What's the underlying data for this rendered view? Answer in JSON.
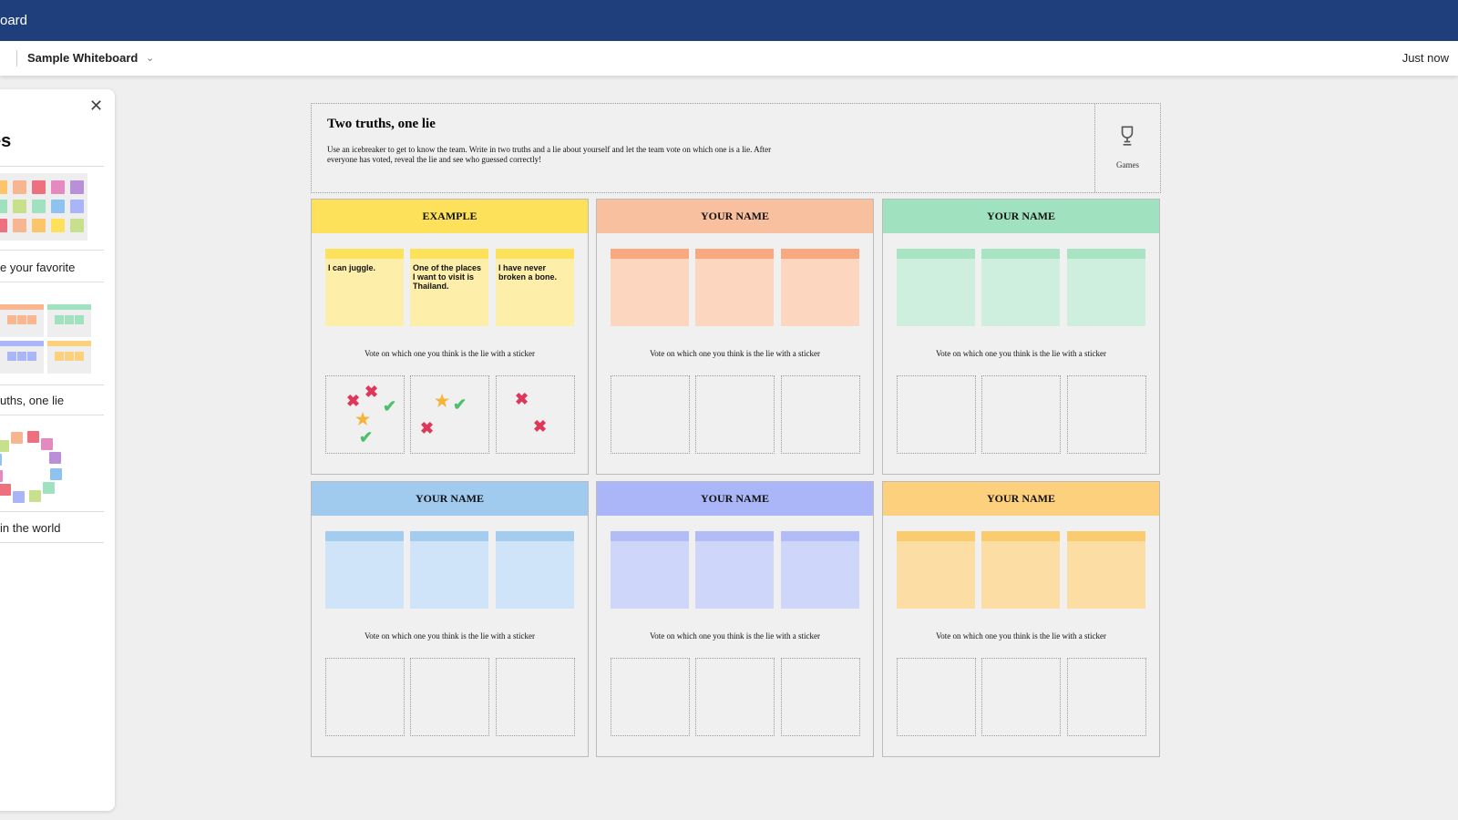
{
  "app": {
    "title": "oard"
  },
  "toolbar": {
    "board_name": "Sample Whiteboard",
    "saved_status": "Just now"
  },
  "panel": {
    "heading": "es",
    "templates": [
      {
        "label": "e your favorite"
      },
      {
        "label": "uths, one lie"
      },
      {
        "label": " in the world"
      }
    ]
  },
  "board": {
    "title": "Two truths, one lie",
    "description": "Use an icebreaker to get to know the team. Write in two truths and a lie about yourself and let the team vote on which one is a lie. After everyone has voted, reveal the lie and see who guessed correctly!",
    "category_label": "Games",
    "category_icon": "trophy-icon",
    "vote_prompt": "Vote on which one you think is the lie with a sticker",
    "cards": [
      {
        "title": "EXAMPLE",
        "header_color": "#fde15a",
        "sticky_color": "#fdeeaa",
        "sticky_bar": "#fde15a",
        "notes": [
          "I can juggle.",
          "One of the places I want to visit is Thailand.",
          "I have never broken a bone."
        ],
        "votes": [
          [
            "x",
            "x",
            "check",
            "star",
            "check"
          ],
          [
            "star",
            "check",
            "x"
          ],
          [
            "x",
            "x"
          ]
        ]
      },
      {
        "title": "YOUR NAME",
        "header_color": "#f9c09f",
        "sticky_color": "#fdd6bf",
        "sticky_bar": "#f9a97f",
        "notes": [
          "",
          "",
          ""
        ],
        "votes": [
          [],
          [],
          []
        ]
      },
      {
        "title": "YOUR NAME",
        "header_color": "#a0e1c0",
        "sticky_color": "#ceeede",
        "sticky_bar": "#a8e3c4",
        "notes": [
          "",
          "",
          ""
        ],
        "votes": [
          [],
          [],
          []
        ]
      },
      {
        "title": "YOUR NAME",
        "header_color": "#a0cbef",
        "sticky_color": "#cfe4f8",
        "sticky_bar": "#a4ccef",
        "notes": [
          "",
          "",
          ""
        ],
        "votes": [
          [],
          [],
          []
        ]
      },
      {
        "title": "YOUR NAME",
        "header_color": "#aab6f7",
        "sticky_color": "#ced6fa",
        "sticky_bar": "#b2bdf7",
        "notes": [
          "",
          "",
          ""
        ],
        "votes": [
          [],
          [],
          []
        ]
      },
      {
        "title": "YOUR NAME",
        "header_color": "#fcd07d",
        "sticky_color": "#fcdea5",
        "sticky_bar": "#fbcc6f",
        "notes": [
          "",
          "",
          ""
        ],
        "votes": [
          [],
          [],
          []
        ]
      }
    ]
  },
  "sticker_colors": {
    "x": "#e0365a",
    "check": "#4cc06a",
    "star": "#f5b435"
  }
}
